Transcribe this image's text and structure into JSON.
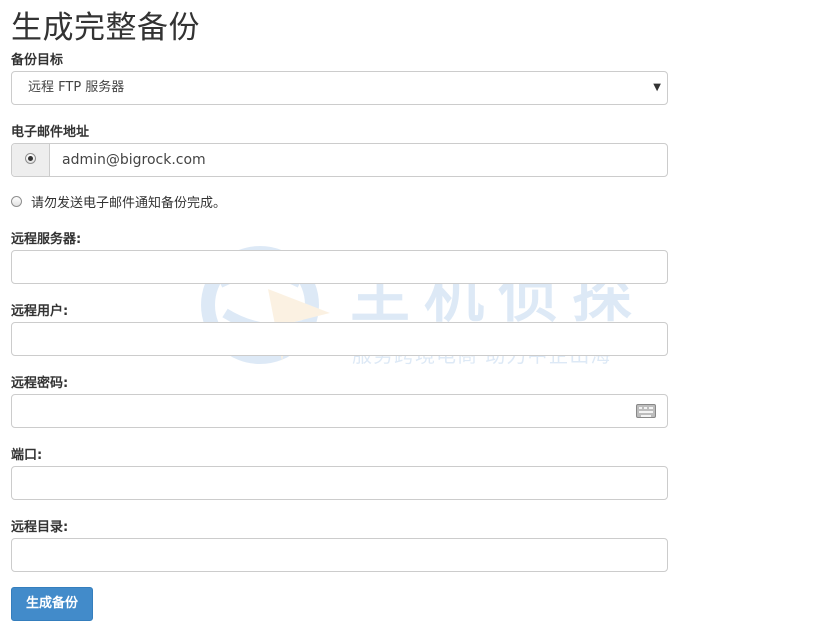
{
  "page": {
    "title": "生成完整备份"
  },
  "form": {
    "destination": {
      "label": "备份目标",
      "selected": "远程 FTP 服务器"
    },
    "email": {
      "label": "电子邮件地址",
      "value": "admin@bigrock.com"
    },
    "no_email_option": {
      "label": "请勿发送电子邮件通知备份完成。"
    },
    "remote_server": {
      "label": "远程服务器:",
      "value": ""
    },
    "remote_user": {
      "label": "远程用户:",
      "value": ""
    },
    "remote_password": {
      "label": "远程密码:",
      "value": ""
    },
    "port": {
      "label": "端口:",
      "value": ""
    },
    "remote_dir": {
      "label": "远程目录:",
      "value": ""
    },
    "submit_label": "生成备份"
  },
  "watermark": {
    "main": "主机侦探",
    "sub": "服务跨境电商 助力中企出海"
  },
  "colors": {
    "primary_button": "#428bca",
    "border": "#cccccc",
    "addon_bg": "#eeeeee",
    "watermark": "#1a6bc4"
  },
  "icons": {
    "select_caret": "caret-down-icon",
    "password_keyboard": "keyboard-icon",
    "watermark_logo": "globe-logo-icon"
  }
}
